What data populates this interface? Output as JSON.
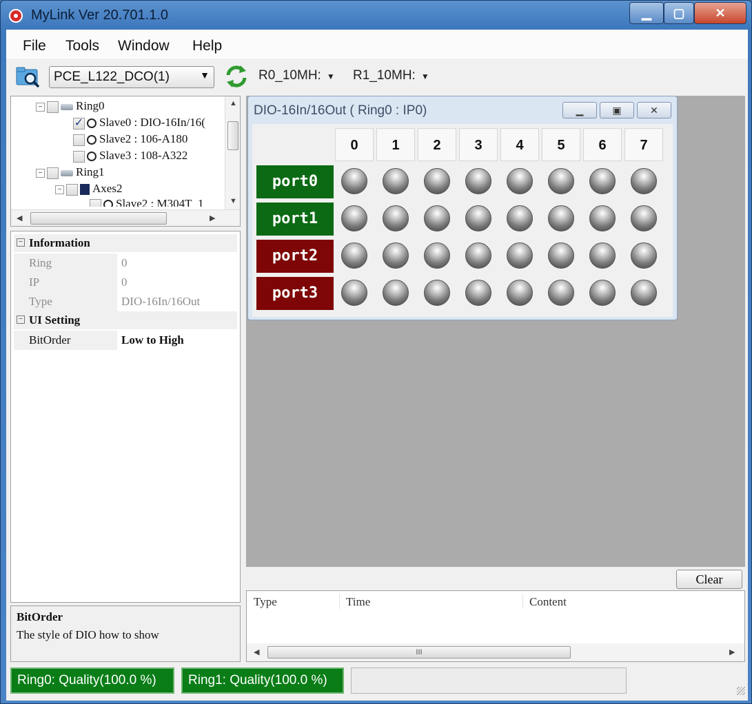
{
  "window": {
    "title": "MyLink   Ver 20.701.1.0",
    "min_label": "▁",
    "max_label": "▢",
    "close_label": "✕"
  },
  "menu": [
    {
      "label": "File"
    },
    {
      "label": "Tools"
    },
    {
      "label": "Window"
    },
    {
      "label": "Help"
    }
  ],
  "toolbar": {
    "device": "PCE_L122_DCO(1)",
    "ring0_speed": "R0_10MH:",
    "ring1_speed": "R1_10MH:"
  },
  "tree": [
    {
      "label": "Ring0",
      "icon": "ring-icon",
      "checked": false,
      "expander": "−"
    },
    {
      "label": "Slave0 : DIO-16In/16(",
      "icon": "slave-icon",
      "checked": true
    },
    {
      "label": "Slave2 : 106-A180",
      "icon": "slave-icon",
      "checked": false
    },
    {
      "label": "Slave3 : 108-A322",
      "icon": "slave-icon",
      "checked": false
    },
    {
      "label": "Ring1",
      "icon": "ring-icon",
      "checked": false,
      "expander": "−"
    },
    {
      "label": "Axes2",
      "icon": "axes-icon",
      "checked": false,
      "expander": "−"
    },
    {
      "label": "Slave2 : M304T_1",
      "icon": "slave-icon",
      "checked": false
    }
  ],
  "properties": {
    "information": {
      "title": "Information",
      "rows": [
        {
          "key": "Ring",
          "value": "0"
        },
        {
          "key": "IP",
          "value": "0"
        },
        {
          "key": "Type",
          "value": "DIO-16In/16Out"
        }
      ]
    },
    "ui_setting": {
      "title": "UI Setting",
      "rows": [
        {
          "key": "BitOrder",
          "value": "Low to High"
        }
      ]
    }
  },
  "description": {
    "title": "BitOrder",
    "text": "The style of DIO how to show"
  },
  "dio_window": {
    "title": "DIO-16In/16Out ( Ring0 : IP0)",
    "bits": [
      "0",
      "1",
      "2",
      "3",
      "4",
      "5",
      "6",
      "7"
    ],
    "ports": [
      {
        "label": "port0",
        "color": "#0b6a13"
      },
      {
        "label": "port1",
        "color": "#0b6a13"
      },
      {
        "label": "port2",
        "color": "#7e0606"
      },
      {
        "label": "port3",
        "color": "#7e0606"
      }
    ]
  },
  "log": {
    "clear_label": "Clear",
    "columns": [
      "Type",
      "Time",
      "Content"
    ],
    "scroll_grip": "III"
  },
  "status": {
    "ring0": "Ring0: Quality(100.0 %)",
    "ring1": "Ring1: Quality(100.0 %)"
  }
}
